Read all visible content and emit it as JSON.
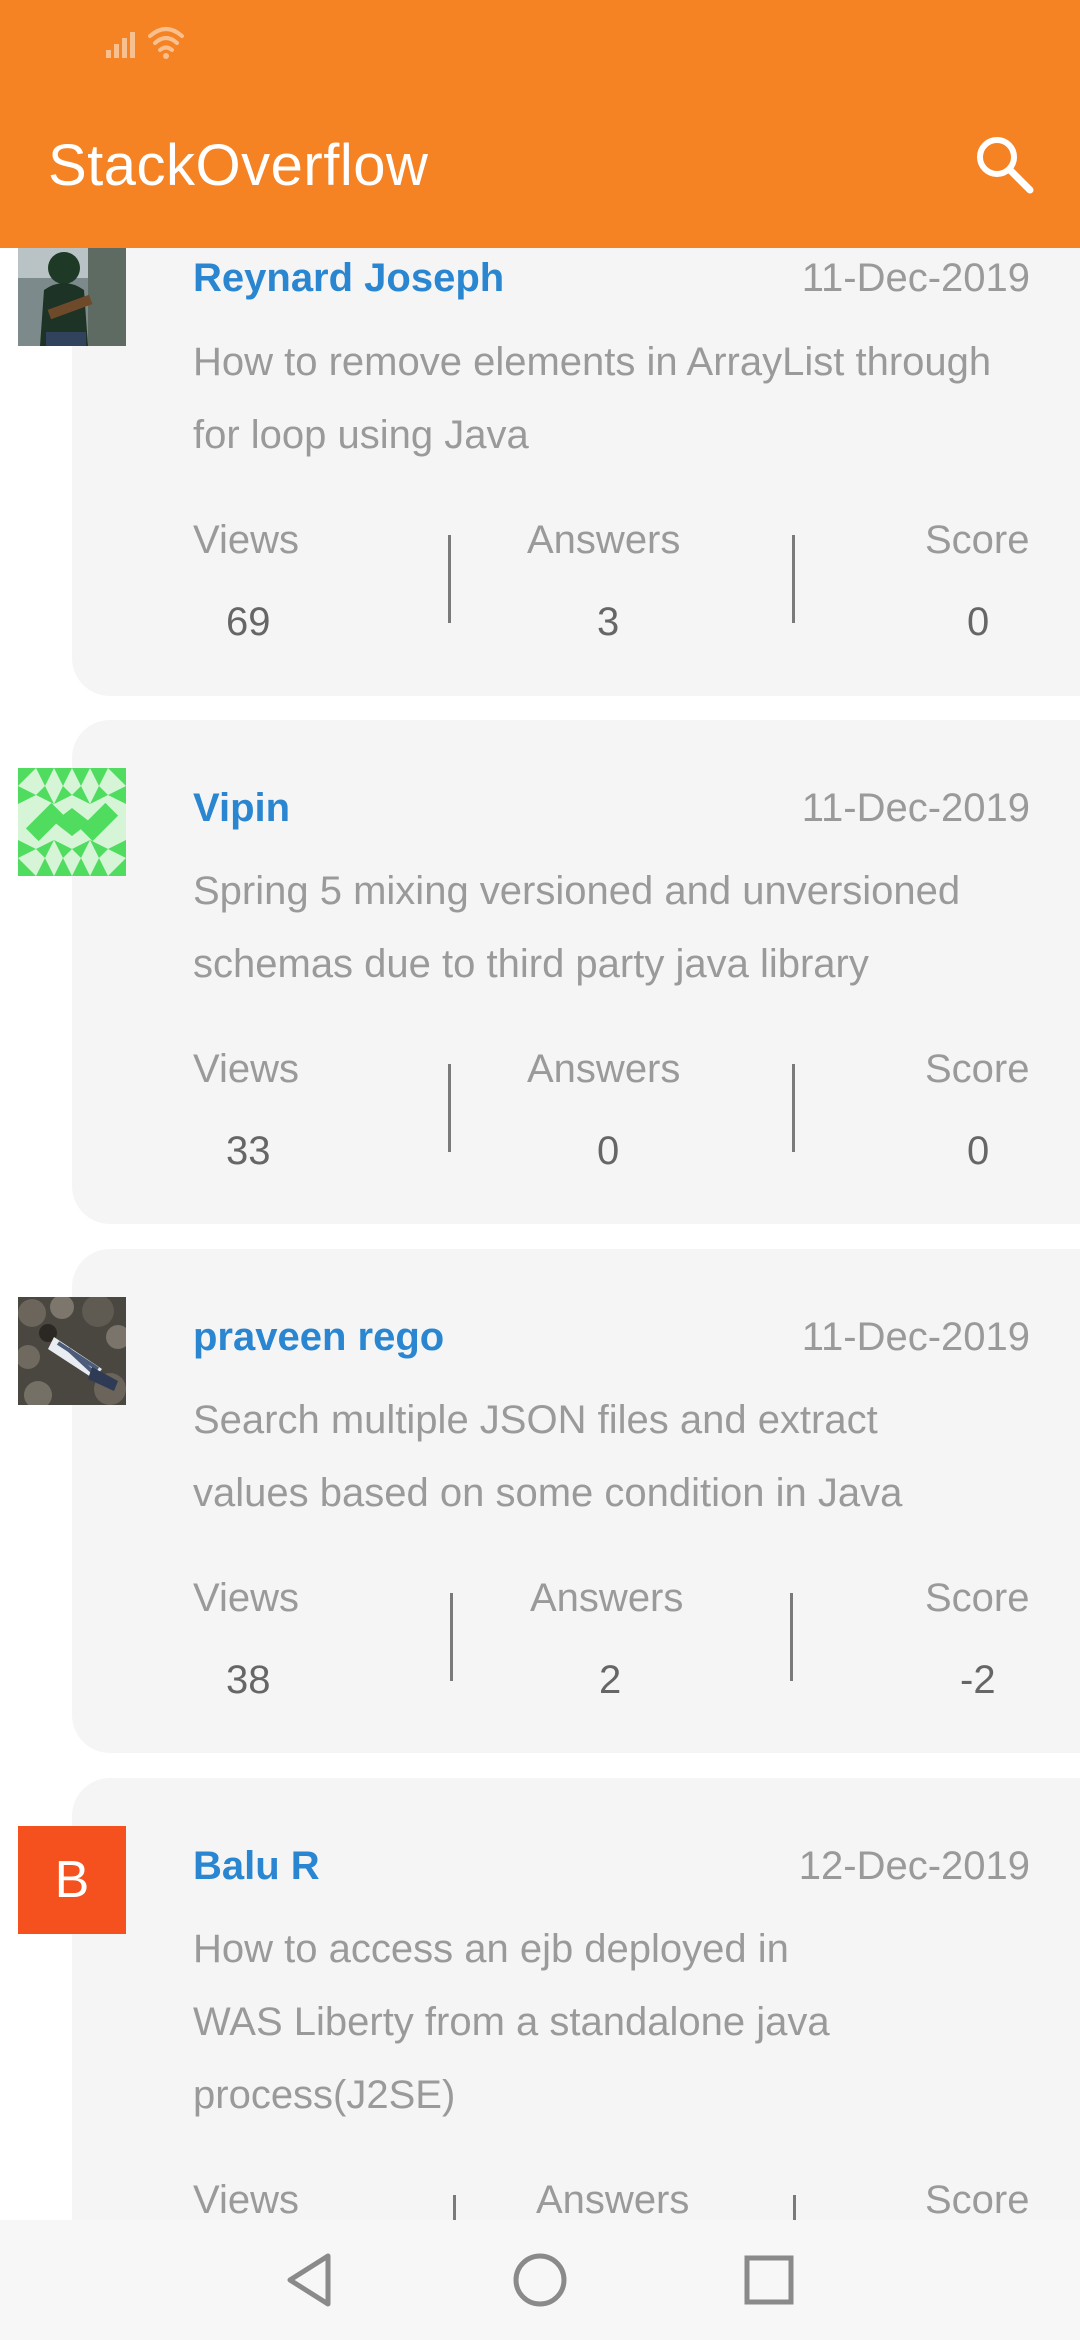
{
  "app": {
    "title": "StackOverflow"
  },
  "stats_labels": {
    "views": "Views",
    "answers": "Answers",
    "score": "Score"
  },
  "questions": [
    {
      "author": "Reynard Joseph",
      "date": "11-Dec-2019",
      "lines": [
        "How to remove elements in ArrayList through",
        "for loop using Java"
      ],
      "views": "69",
      "answers": "3",
      "score": "0",
      "avatar": "photo-guitarist"
    },
    {
      "author": "Vipin",
      "date": "11-Dec-2019",
      "lines": [
        "Spring 5 mixing versioned and unversioned",
        "schemas due to third party java library"
      ],
      "views": "33",
      "answers": "0",
      "score": "0",
      "avatar": "identicon-green"
    },
    {
      "author": "praveen rego",
      "date": "11-Dec-2019",
      "lines": [
        "Search multiple JSON files and extract",
        "values based on some condition in Java"
      ],
      "views": "38",
      "answers": "2",
      "score": "-2",
      "avatar": "photo-rocks"
    },
    {
      "author": "Balu R",
      "date": "12-Dec-2019",
      "lines": [
        "How to access an ejb deployed in",
        "WAS Liberty from a standalone java",
        "process(J2SE)"
      ],
      "avatar": "letter",
      "avatar_letter": "B",
      "avatar_color": "#f4511e"
    }
  ],
  "colors": {
    "app_bar": "#f58223",
    "author_link": "#2a86d0",
    "card_bg": "#f5f5f5",
    "muted_text": "#9a9a9a"
  },
  "icons": {
    "status": "signal-wifi-icons",
    "search": "search-icon",
    "nav_back": "back-triangle-icon",
    "nav_home": "home-circle-icon",
    "nav_recents": "recents-square-icon"
  }
}
